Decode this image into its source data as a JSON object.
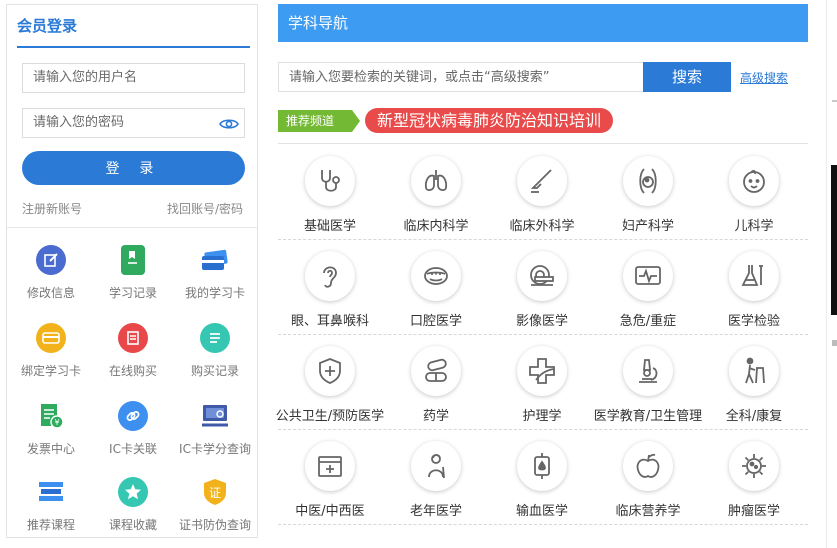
{
  "login": {
    "title": "会员登录",
    "username_placeholder": "请输入您的用户名",
    "password_placeholder": "请输入您的密码",
    "button_label": "登 录",
    "register_link": "注册新账号",
    "forgot_link": "找回账号/密码"
  },
  "member_menu": {
    "items": [
      {
        "label": "修改信息",
        "icon": "edit-icon",
        "color": "#4a6bd0"
      },
      {
        "label": "学习记录",
        "icon": "bookmark-doc-icon",
        "color": "#2faa5e"
      },
      {
        "label": "我的学习卡",
        "icon": "card-icon",
        "color": "#3d8ff0"
      },
      {
        "label": "绑定学习卡",
        "icon": "bind-card-icon",
        "color": "#f2b21c"
      },
      {
        "label": "在线购买",
        "icon": "cart-icon",
        "color": "#e8484a"
      },
      {
        "label": "购买记录",
        "icon": "receipt-icon",
        "color": "#35c7b1"
      },
      {
        "label": "发票中心",
        "icon": "invoice-icon",
        "color": "#2faa5e"
      },
      {
        "label": "IC卡关联",
        "icon": "link-icon",
        "color": "#3d8ff0"
      },
      {
        "label": "IC卡学分查询",
        "icon": "credit-search-icon",
        "color": "#3f5aa8"
      },
      {
        "label": "推荐课程",
        "icon": "books-icon",
        "color": "#3d8ff0"
      },
      {
        "label": "课程收藏",
        "icon": "star-icon",
        "color": "#35c7b1"
      },
      {
        "label": "证书防伪查询",
        "icon": "certificate-icon",
        "color": "#f2b21c"
      }
    ]
  },
  "nav": {
    "title": "学科导航",
    "search_placeholder": "请输入您要检索的关键词，或点击“高级搜索”",
    "search_button": "搜索",
    "advanced_link": "高级搜索"
  },
  "recommend": {
    "tag": "推荐频道",
    "banner": "新型冠状病毒肺炎防治知识培训"
  },
  "categories": [
    {
      "label": "基础医学",
      "icon": "stethoscope-icon"
    },
    {
      "label": "临床内科学",
      "icon": "lungs-icon"
    },
    {
      "label": "临床外科学",
      "icon": "scalpel-icon"
    },
    {
      "label": "妇产科学",
      "icon": "pregnancy-icon"
    },
    {
      "label": "儿科学",
      "icon": "baby-face-icon"
    },
    {
      "label": "眼、耳鼻喉科",
      "icon": "ear-icon"
    },
    {
      "label": "口腔医学",
      "icon": "mouth-icon"
    },
    {
      "label": "影像医学",
      "icon": "ct-scanner-icon"
    },
    {
      "label": "急危/重症",
      "icon": "ecg-monitor-icon"
    },
    {
      "label": "医学检验",
      "icon": "lab-flask-icon"
    },
    {
      "label": "公共卫生/预防医学",
      "icon": "shield-cross-icon"
    },
    {
      "label": "药学",
      "icon": "pills-icon"
    },
    {
      "label": "护理学",
      "icon": "nursing-cross-icon"
    },
    {
      "label": "医学教育/卫生管理",
      "icon": "microscope-icon"
    },
    {
      "label": "全科/康复",
      "icon": "walker-icon"
    },
    {
      "label": "中医/中西医",
      "icon": "medicine-box-icon"
    },
    {
      "label": "老年医学",
      "icon": "elderly-icon"
    },
    {
      "label": "输血医学",
      "icon": "blood-bag-icon"
    },
    {
      "label": "临床营养学",
      "icon": "apple-icon"
    },
    {
      "label": "肿瘤医学",
      "icon": "tumor-cell-icon"
    }
  ]
}
